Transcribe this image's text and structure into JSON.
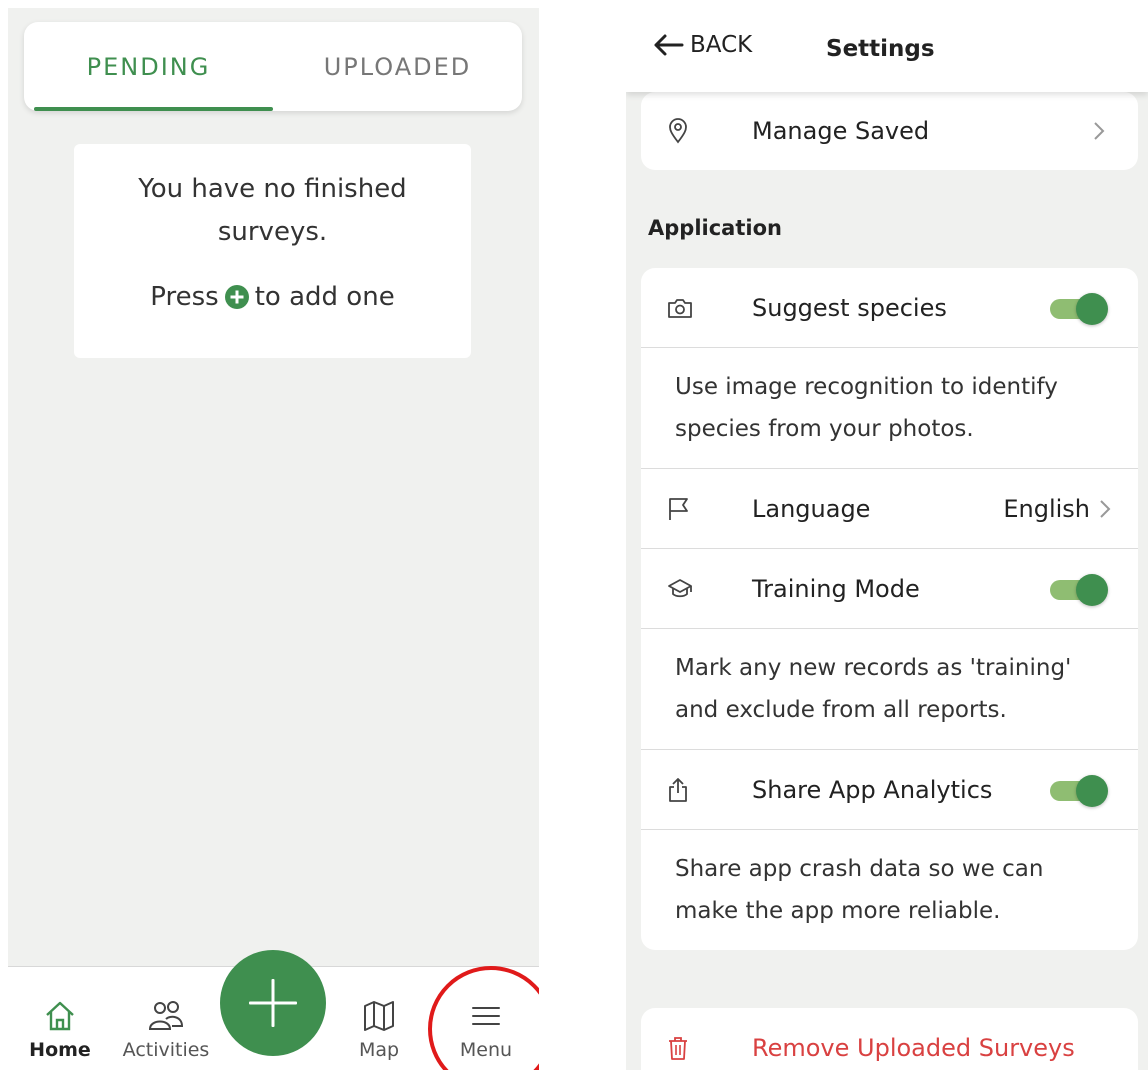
{
  "left": {
    "tabs": [
      {
        "label": "PENDING",
        "active": true
      },
      {
        "label": "UPLOADED",
        "active": false
      }
    ],
    "empty_state": {
      "message": "You have no finished surveys.",
      "hint_prefix": "Press",
      "hint_suffix": "to add one"
    },
    "bottom_nav": [
      {
        "label": "Home",
        "icon": "home-icon",
        "active": true
      },
      {
        "label": "Activities",
        "icon": "people-icon",
        "active": false
      },
      {
        "label": "Map",
        "icon": "map-icon",
        "active": false
      },
      {
        "label": "Menu",
        "icon": "menu-icon",
        "active": false
      }
    ],
    "accent_color": "#3f8f4f",
    "highlight_color": "#e01a1a"
  },
  "right": {
    "header": {
      "back_label": "BACK",
      "title": "Settings"
    },
    "manage_saved": {
      "label": "Manage Saved",
      "icon": "location-pin-icon"
    },
    "section_title": "Application",
    "settings": [
      {
        "label": "Suggest species",
        "icon": "camera-icon",
        "toggle": true,
        "description": "Use image recognition to identify species from your photos."
      },
      {
        "label": "Language",
        "icon": "flag-icon",
        "value": "English"
      },
      {
        "label": "Training Mode",
        "icon": "graduation-cap-icon",
        "toggle": true,
        "description": "Mark any new records as 'training' and exclude from all reports."
      },
      {
        "label": "Share App Analytics",
        "icon": "share-icon",
        "toggle": true,
        "description": "Share app crash data so we can make the app more reliable."
      }
    ],
    "danger": {
      "label": "Remove Uploaded Surveys",
      "icon": "trash-icon",
      "color": "#d94141"
    }
  }
}
